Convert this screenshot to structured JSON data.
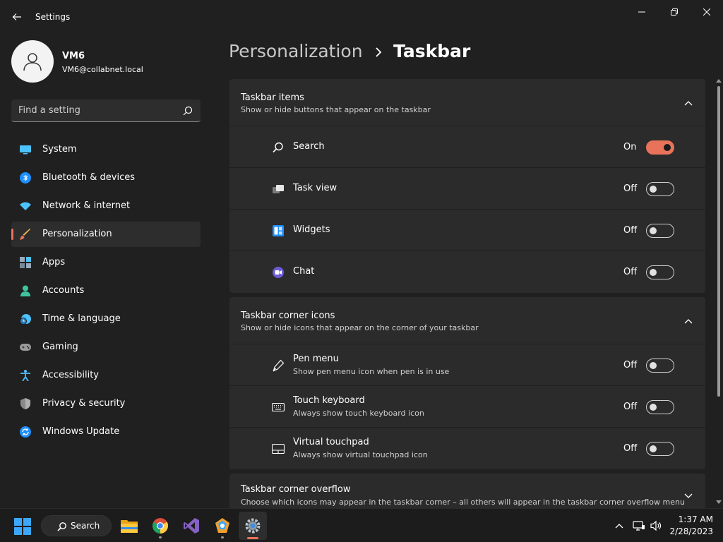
{
  "window": {
    "title": "Settings"
  },
  "profile": {
    "name": "VM6",
    "email": "VM6@collabnet.local"
  },
  "search": {
    "placeholder": "Find a setting"
  },
  "sidebar": {
    "items": [
      {
        "label": "System",
        "icon": "monitor-icon"
      },
      {
        "label": "Bluetooth & devices",
        "icon": "bluetooth-icon"
      },
      {
        "label": "Network & internet",
        "icon": "wifi-icon"
      },
      {
        "label": "Personalization",
        "icon": "brush-icon",
        "active": true
      },
      {
        "label": "Apps",
        "icon": "apps-icon"
      },
      {
        "label": "Accounts",
        "icon": "person-icon"
      },
      {
        "label": "Time & language",
        "icon": "clock-globe-icon"
      },
      {
        "label": "Gaming",
        "icon": "gamepad-icon"
      },
      {
        "label": "Accessibility",
        "icon": "accessibility-icon"
      },
      {
        "label": "Privacy & security",
        "icon": "shield-icon"
      },
      {
        "label": "Windows Update",
        "icon": "update-icon"
      }
    ]
  },
  "breadcrumb": {
    "parent": "Personalization",
    "current": "Taskbar"
  },
  "sections": {
    "taskbar_items": {
      "title": "Taskbar items",
      "subtitle": "Show or hide buttons that appear on the taskbar",
      "rows": [
        {
          "label": "Search",
          "state": "On",
          "on": true
        },
        {
          "label": "Task view",
          "state": "Off",
          "on": false
        },
        {
          "label": "Widgets",
          "state": "Off",
          "on": false
        },
        {
          "label": "Chat",
          "state": "Off",
          "on": false
        }
      ]
    },
    "corner_icons": {
      "title": "Taskbar corner icons",
      "subtitle": "Show or hide icons that appear on the corner of your taskbar",
      "rows": [
        {
          "label": "Pen menu",
          "desc": "Show pen menu icon when pen is in use",
          "state": "Off",
          "on": false
        },
        {
          "label": "Touch keyboard",
          "desc": "Always show touch keyboard icon",
          "state": "Off",
          "on": false
        },
        {
          "label": "Virtual touchpad",
          "desc": "Always show virtual touchpad icon",
          "state": "Off",
          "on": false
        }
      ]
    },
    "corner_overflow": {
      "title": "Taskbar corner overflow",
      "subtitle": "Choose which icons may appear in the taskbar corner – all others will appear in the taskbar corner overflow menu"
    }
  },
  "taskbar": {
    "search_label": "Search",
    "time": "1:37 AM",
    "date": "2/28/2023"
  },
  "colors": {
    "accent": "#e8735a",
    "background": "#202020",
    "card": "#2b2b2b"
  }
}
